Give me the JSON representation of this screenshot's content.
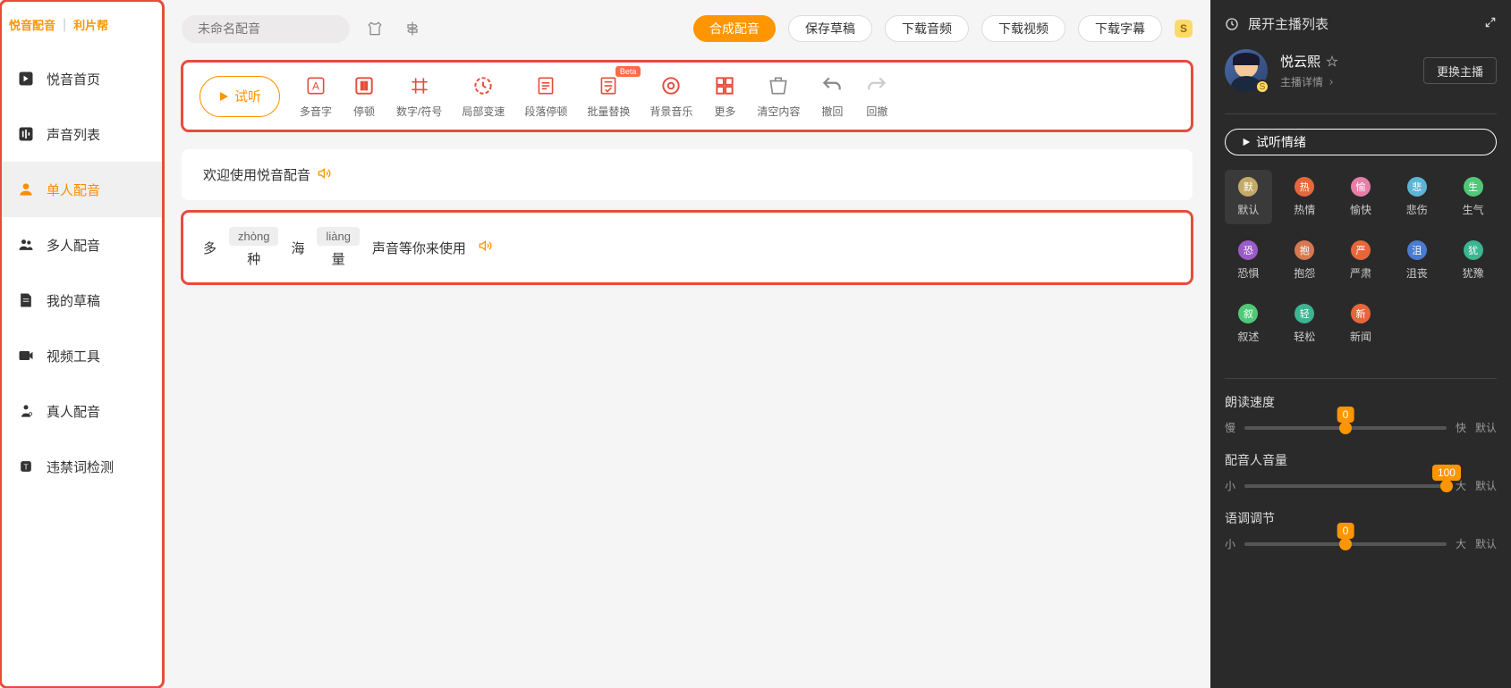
{
  "logo": {
    "brand1": "悦音配音",
    "brand2": "利片帮"
  },
  "nav": [
    {
      "label": "悦音首页",
      "name": "nav-home"
    },
    {
      "label": "声音列表",
      "name": "nav-voice-list"
    },
    {
      "label": "单人配音",
      "name": "nav-single-dub"
    },
    {
      "label": "多人配音",
      "name": "nav-multi-dub"
    },
    {
      "label": "我的草稿",
      "name": "nav-drafts"
    },
    {
      "label": "视频工具",
      "name": "nav-video"
    },
    {
      "label": "真人配音",
      "name": "nav-human"
    },
    {
      "label": "违禁词检测",
      "name": "nav-banned"
    }
  ],
  "topbar": {
    "placeholder": "未命名配音",
    "synth": "合成配音",
    "save": "保存草稿",
    "dlAudio": "下载音频",
    "dlVideo": "下载视频",
    "dlSub": "下载字幕",
    "badge": "S"
  },
  "toolbar": {
    "listen": "试听",
    "items": [
      {
        "label": "多音字",
        "name": "tool-polyphone"
      },
      {
        "label": "停顿",
        "name": "tool-pause"
      },
      {
        "label": "数字/符号",
        "name": "tool-number"
      },
      {
        "label": "局部变速",
        "name": "tool-speed"
      },
      {
        "label": "段落停顿",
        "name": "tool-para-pause"
      },
      {
        "label": "批量替换",
        "name": "tool-replace",
        "beta": "Beta"
      },
      {
        "label": "背景音乐",
        "name": "tool-bgm"
      },
      {
        "label": "更多",
        "name": "tool-more"
      },
      {
        "label": "清空内容",
        "name": "tool-clear"
      },
      {
        "label": "撤回",
        "name": "tool-undo"
      },
      {
        "label": "回撤",
        "name": "tool-redo"
      }
    ]
  },
  "row1": "欢迎使用悦音配音",
  "row2": {
    "c1": "多",
    "c2": "种",
    "p2": "zhòng",
    "c3": "海",
    "c4": "量",
    "p4": "liàng",
    "rest": "声音等你来使用"
  },
  "right": {
    "header": "展开主播列表",
    "anchorName": "悦云熙",
    "anchorSub": "主播详情",
    "change": "更换主播",
    "emotionBtn": "试听情绪",
    "emotions": [
      {
        "label": "默认",
        "short": "默",
        "color": "#c4a968"
      },
      {
        "label": "热情",
        "short": "热",
        "color": "#e8663c"
      },
      {
        "label": "愉快",
        "short": "愉",
        "color": "#e87ea8"
      },
      {
        "label": "悲伤",
        "short": "悲",
        "color": "#5bb5d4"
      },
      {
        "label": "生气",
        "short": "生",
        "color": "#4fc978"
      },
      {
        "label": "恐惧",
        "short": "恐",
        "color": "#9b5bc9"
      },
      {
        "label": "抱怨",
        "short": "抱",
        "color": "#d97850"
      },
      {
        "label": "严肃",
        "short": "严",
        "color": "#e8663c"
      },
      {
        "label": "沮丧",
        "short": "沮",
        "color": "#4a7bd4"
      },
      {
        "label": "犹豫",
        "short": "犹",
        "color": "#3cb591"
      },
      {
        "label": "叙述",
        "short": "叙",
        "color": "#4fc978"
      },
      {
        "label": "轻松",
        "short": "轻",
        "color": "#3cb591"
      },
      {
        "label": "新闻",
        "short": "新",
        "color": "#e8663c"
      }
    ],
    "sliders": [
      {
        "title": "朗读速度",
        "val": "0",
        "pos": 50,
        "min": "慢",
        "max": "快",
        "def": "默认"
      },
      {
        "title": "配音人音量",
        "val": "100",
        "pos": 100,
        "min": "小",
        "max": "大",
        "def": "默认"
      },
      {
        "title": "语调调节",
        "val": "0",
        "pos": 50,
        "min": "小",
        "max": "大",
        "def": "默认"
      }
    ]
  }
}
